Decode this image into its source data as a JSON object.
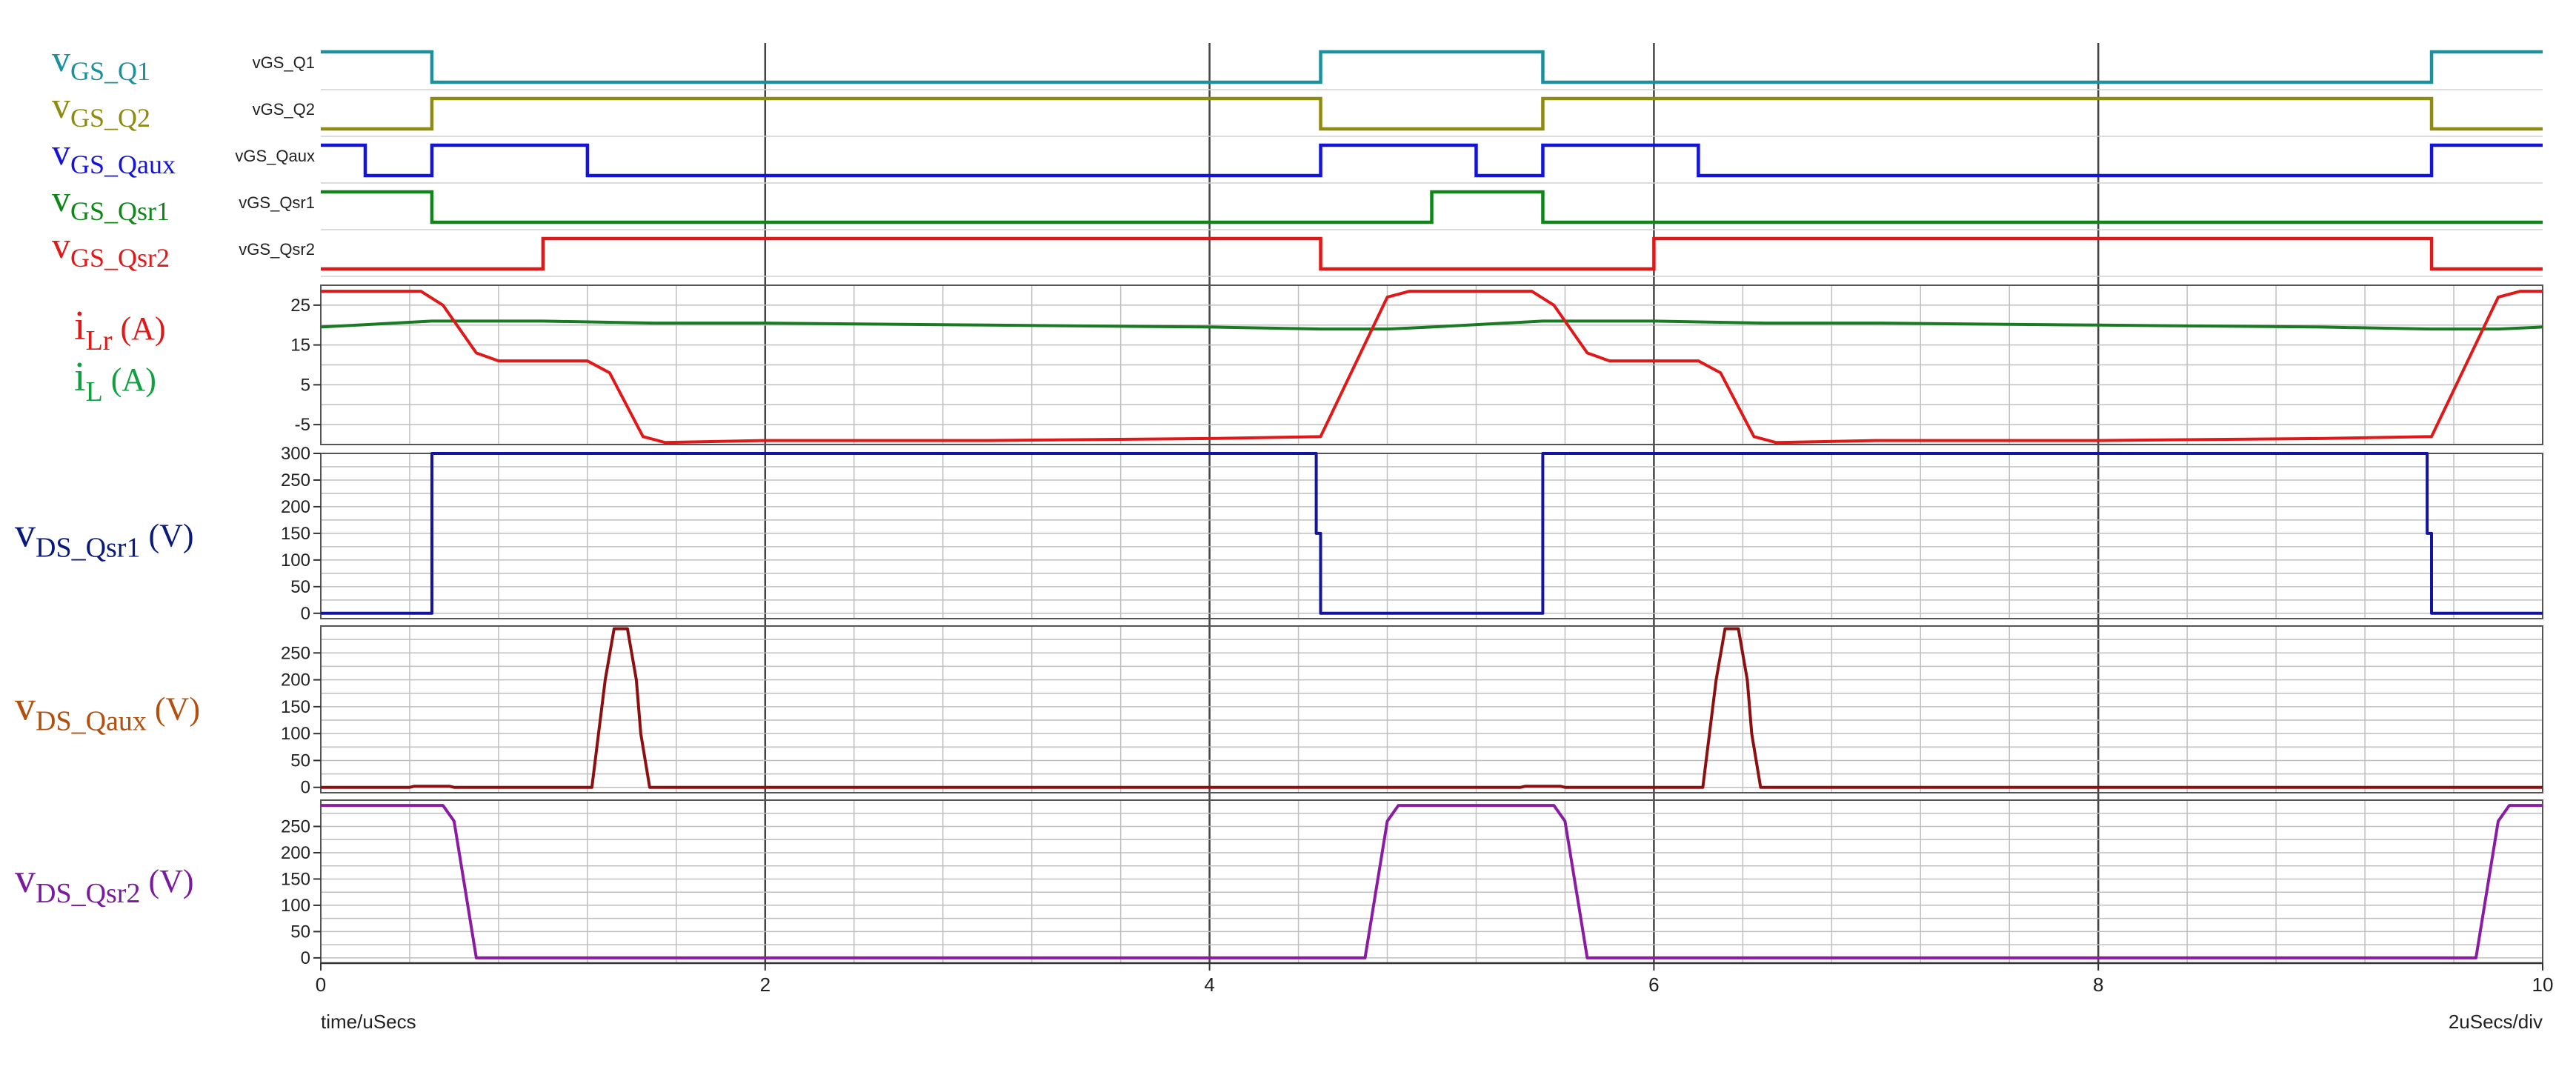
{
  "chart_data": {
    "type": "line",
    "xlabel": "time/uSecs",
    "scale_label": "2uSecs/div",
    "x_axis": {
      "range": [
        0,
        10
      ],
      "ticks": [
        "0",
        "2",
        "4",
        "6",
        "8",
        "10"
      ]
    },
    "grid": true,
    "panels": [
      {
        "id": "gate",
        "type": "digital",
        "series": [
          {
            "name": "vGS_Q1",
            "label_main": "v",
            "label_sub": "GS_Q1",
            "color": "#1e8f9c",
            "edges": [
              [
                0,
                1
              ],
              [
                0.5,
                0
              ],
              [
                4.5,
                1
              ],
              [
                5.5,
                0
              ],
              [
                9.5,
                1
              ],
              [
                10,
                1
              ]
            ]
          },
          {
            "name": "vGS_Q2",
            "label_main": "v",
            "label_sub": "GS_Q2",
            "color": "#8f8a12",
            "edges": [
              [
                0,
                0
              ],
              [
                0.5,
                1
              ],
              [
                4.5,
                0
              ],
              [
                5.5,
                1
              ],
              [
                9.5,
                0
              ],
              [
                10,
                0
              ]
            ]
          },
          {
            "name": "vGS_Qaux",
            "label_main": "v",
            "label_sub": "GS_Qaux",
            "color": "#1414d8",
            "edges": [
              [
                0,
                1
              ],
              [
                0.2,
                0
              ],
              [
                0.5,
                1
              ],
              [
                1.2,
                0
              ],
              [
                4.5,
                1
              ],
              [
                5.2,
                0
              ],
              [
                5.5,
                1
              ],
              [
                6.2,
                0
              ],
              [
                9.5,
                1
              ],
              [
                10,
                1
              ]
            ]
          },
          {
            "name": "vGS_Qsr1",
            "label_main": "v",
            "label_sub": "GS_Qsr1",
            "color": "#10861a",
            "edges": [
              [
                0,
                1
              ],
              [
                0.5,
                0
              ],
              [
                5.0,
                1
              ],
              [
                5.5,
                0
              ],
              [
                10,
                0
              ]
            ]
          },
          {
            "name": "vGS_Qsr2",
            "label_main": "v",
            "label_sub": "GS_Qsr2",
            "color": "#e01818",
            "edges": [
              [
                0,
                0
              ],
              [
                1.0,
                1
              ],
              [
                4.5,
                0
              ],
              [
                6.0,
                1
              ],
              [
                9.5,
                0
              ],
              [
                10,
                0
              ]
            ]
          }
        ]
      },
      {
        "id": "currents",
        "type": "analog",
        "ylim": [
          -10,
          30
        ],
        "yticks": [
          "25",
          "15",
          "5",
          "-5"
        ],
        "ytick_values": [
          25,
          15,
          5,
          -5
        ],
        "grid_step": 5,
        "labels": [
          {
            "main": "i",
            "sub": "Lr",
            "unit": "(A)",
            "color": "#e01818"
          },
          {
            "main": "i",
            "sub": "L",
            "unit": "(A)",
            "color": "#10a040"
          }
        ],
        "series": [
          {
            "name": "iL",
            "color": "#1a7a22",
            "x": [
              0,
              0.5,
              1.0,
              1.5,
              2.0,
              3.0,
              4.0,
              4.5,
              4.8,
              5.0,
              5.5,
              6.0,
              6.5,
              7.0,
              8.0,
              9.0,
              9.5,
              9.8,
              10
            ],
            "y": [
              19.5,
              21,
              21,
              20.5,
              20.5,
              20,
              19.5,
              19,
              19,
              19.5,
              21,
              21,
              20.5,
              20.5,
              20,
              19.5,
              19,
              19,
              19.5
            ]
          },
          {
            "name": "iLr",
            "color": "#e01818",
            "x": [
              0,
              0.45,
              0.55,
              0.7,
              0.8,
              1.2,
              1.3,
              1.45,
              1.55,
              2.0,
              3.0,
              4.0,
              4.5,
              4.8,
              4.9,
              5.45,
              5.55,
              5.7,
              5.8,
              6.2,
              6.3,
              6.45,
              6.55,
              7.0,
              8.0,
              9.0,
              9.5,
              9.8,
              9.9,
              10
            ],
            "y": [
              28.5,
              28.5,
              25,
              13,
              11,
              11,
              8,
              -8,
              -9.5,
              -9,
              -9,
              -8.5,
              -8,
              27,
              28.5,
              28.5,
              25,
              13,
              11,
              11,
              8,
              -8,
              -9.5,
              -9,
              -9,
              -8.5,
              -8,
              27,
              28.5,
              28.5
            ]
          }
        ]
      },
      {
        "id": "vds_qsr1",
        "type": "analog",
        "ylim": [
          -10,
          300
        ],
        "yticks": [
          "300",
          "250",
          "200",
          "150",
          "100",
          "50",
          "0"
        ],
        "ytick_values": [
          300,
          250,
          200,
          150,
          100,
          50,
          0
        ],
        "grid_step": 25,
        "labels": [
          {
            "main": "v",
            "sub": "DS_Qsr1",
            "unit": "(V)",
            "color": "#0a1a7a"
          }
        ],
        "series": [
          {
            "name": "vDS_Qsr1",
            "color": "#14149c",
            "x": [
              0,
              0.5,
              0.5,
              4.48,
              4.48,
              4.5,
              4.5,
              5.5,
              5.5,
              9.48,
              9.48,
              9.5,
              9.5,
              10
            ],
            "y": [
              0,
              0,
              300,
              300,
              150,
              150,
              0,
              0,
              300,
              300,
              150,
              150,
              0,
              0
            ]
          }
        ]
      },
      {
        "id": "vds_qaux",
        "type": "analog",
        "ylim": [
          -10,
          300
        ],
        "yticks": [
          "250",
          "200",
          "150",
          "100",
          "50",
          "0"
        ],
        "ytick_values": [
          250,
          200,
          150,
          100,
          50,
          0
        ],
        "grid_step": 25,
        "labels": [
          {
            "main": "v",
            "sub": "DS_Qaux",
            "unit": "(V)",
            "color": "#b3500e"
          }
        ],
        "series": [
          {
            "name": "vDS_Qaux",
            "color": "#8c1010",
            "x": [
              0,
              0.4,
              0.42,
              0.58,
              0.6,
              1.22,
              1.28,
              1.32,
              1.38,
              1.42,
              1.44,
              1.48,
              5.4,
              5.42,
              5.58,
              5.6,
              6.22,
              6.28,
              6.32,
              6.38,
              6.42,
              6.44,
              6.48,
              10
            ],
            "y": [
              0,
              0,
              2,
              2,
              0,
              0,
              200,
              295,
              295,
              200,
              100,
              0,
              0,
              2,
              2,
              0,
              0,
              200,
              295,
              295,
              200,
              100,
              0,
              0
            ]
          }
        ]
      },
      {
        "id": "vds_qsr2",
        "type": "analog",
        "ylim": [
          -10,
          300
        ],
        "yticks": [
          "250",
          "200",
          "150",
          "100",
          "50",
          "0"
        ],
        "ytick_values": [
          250,
          200,
          150,
          100,
          50,
          0
        ],
        "grid_step": 25,
        "labels": [
          {
            "main": "v",
            "sub": "DS_Qsr2",
            "unit": "(V)",
            "color": "#7a1a9c"
          }
        ],
        "series": [
          {
            "name": "vDS_Qsr2",
            "color": "#8a1ca4",
            "x": [
              0,
              0.55,
              0.6,
              0.65,
              0.7,
              4.7,
              4.75,
              4.8,
              4.85,
              5.55,
              5.6,
              5.65,
              5.7,
              9.7,
              9.75,
              9.8,
              9.85,
              10
            ],
            "y": [
              290,
              290,
              260,
              130,
              0,
              0,
              130,
              260,
              290,
              290,
              260,
              130,
              0,
              0,
              130,
              260,
              290,
              290
            ]
          }
        ]
      }
    ]
  }
}
